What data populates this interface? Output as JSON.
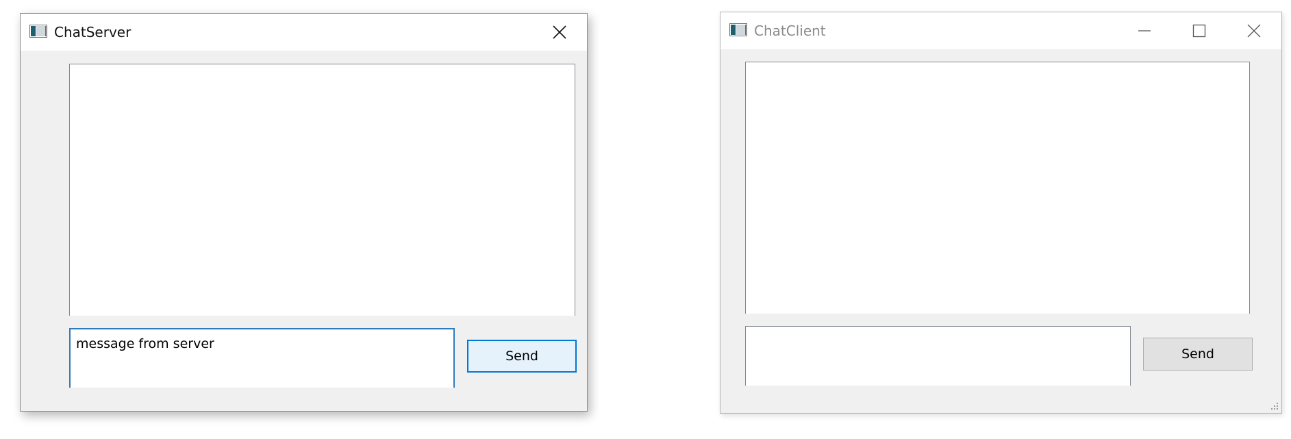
{
  "server_window": {
    "title": "ChatServer",
    "icon": "window-app-icon",
    "caption_buttons": [
      "close"
    ],
    "message_input": {
      "value": "message from server",
      "placeholder": ""
    },
    "send_label": "Send"
  },
  "client_window": {
    "title": "ChatClient",
    "icon": "window-app-icon",
    "caption_buttons": [
      "minimize",
      "maximize",
      "close"
    ],
    "message_input": {
      "value": "",
      "placeholder": ""
    },
    "send_label": "Send"
  },
  "colors": {
    "window_bg": "#f0f0f0",
    "titlebar_bg": "#ffffff",
    "focus_accent": "#0078d7",
    "button_bg": "#e1e1e1"
  }
}
